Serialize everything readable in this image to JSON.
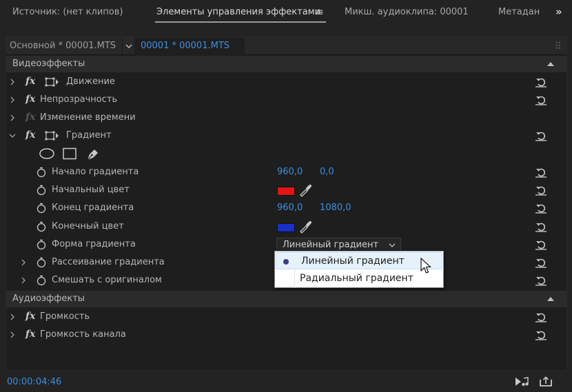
{
  "tabs": {
    "source": "Источник: (нет клипов)",
    "effect_controls": "Элементы управления эффектами",
    "audio_mixer": "Микш. аудиоклипа: 00001",
    "metadata": "Метадан"
  },
  "clipbar": {
    "master": "Основной * 00001.MTS",
    "current": "00001 * 00001.MTS"
  },
  "video_section": "Видеоэффекты",
  "audio_section": "Аудиоэффекты",
  "effects": {
    "motion": "Движение",
    "opacity": "Непрозрачность",
    "time_remap": "Изменение времени",
    "gradient": "Градиент",
    "fx_label": "fx"
  },
  "gradient_params": {
    "start": {
      "label": "Начало градиента",
      "x": "960,0",
      "y": "0,0"
    },
    "start_color": {
      "label": "Начальный цвет",
      "color": "#e51515"
    },
    "end": {
      "label": "Конец градиента",
      "x": "960,0",
      "y": "1080,0"
    },
    "end_color": {
      "label": "Конечный цвет",
      "color": "#1830c8"
    },
    "shape": {
      "label": "Форма градиента",
      "value": "Линейный градиент"
    },
    "scatter": {
      "label": "Рассеивание градиента"
    },
    "blend": {
      "label": "Смешать с оригиналом"
    }
  },
  "dropdown": {
    "options": [
      "Линейный градиент",
      "Радиальный градиент"
    ],
    "selected": "Линейный градиент"
  },
  "audio_effects": {
    "volume": "Громкость",
    "channel_volume": "Громкость канала"
  },
  "footer": {
    "timecode": "00:00:04:46"
  },
  "colors": {
    "accent": "#3a8fe4",
    "background": "#1e1e1e"
  }
}
